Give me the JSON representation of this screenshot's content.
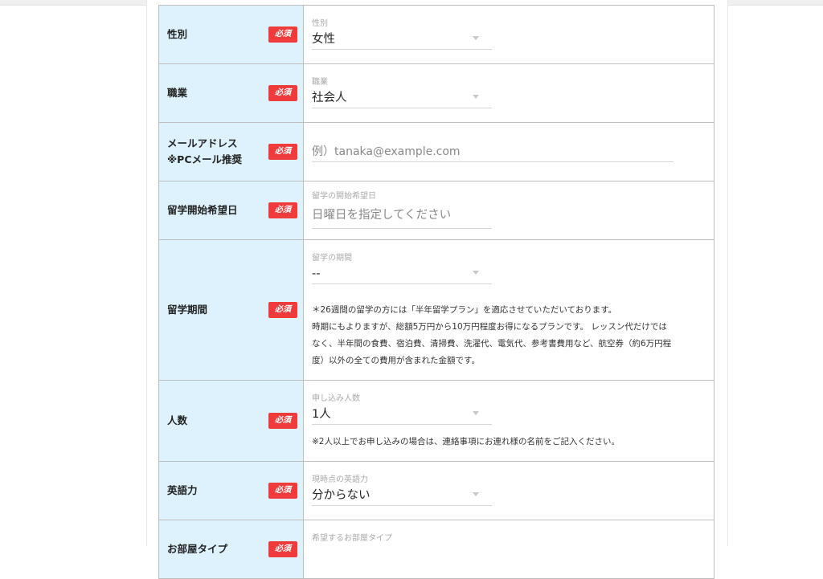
{
  "required_badge": "必須",
  "rows": {
    "gender": {
      "label": "性別",
      "field_label": "性別",
      "value": "女性"
    },
    "occupation": {
      "label": "職業",
      "field_label": "職業",
      "value": "社会人"
    },
    "email": {
      "label_line1": "メールアドレス",
      "label_line2": "※PCメール推奨",
      "placeholder": "例）tanaka@example.com"
    },
    "start_date": {
      "label": "留学開始希望日",
      "field_label": "留学の開始希望日",
      "placeholder": "日曜日を指定してください"
    },
    "duration": {
      "label": "留学期間",
      "field_label": "留学の期間",
      "value": "--",
      "note_lines": [
        "＊26週間の留学の方には「半年留学プラン」を適応させていただいております。",
        "時期にもよりますが、総額5万円から10万円程度お得になるプランです。 レッスン代だけでは",
        "なく、半年間の食費、宿泊費、清掃費、洗濯代、電気代、参考書費用など、航空券（約6万円程",
        "度）以外の全ての費用が含まれた金額です。"
      ]
    },
    "people": {
      "label": "人数",
      "field_label": "申し込み人数",
      "value": "1人",
      "note": "※2人以上でお申し込みの場合は、連絡事項にお連れ様の名前をご記入ください。"
    },
    "english": {
      "label": "英語力",
      "field_label": "現時点の英語力",
      "value": "分からない"
    },
    "room": {
      "label": "お部屋タイプ",
      "field_label": "希望するお部屋タイプ"
    }
  }
}
